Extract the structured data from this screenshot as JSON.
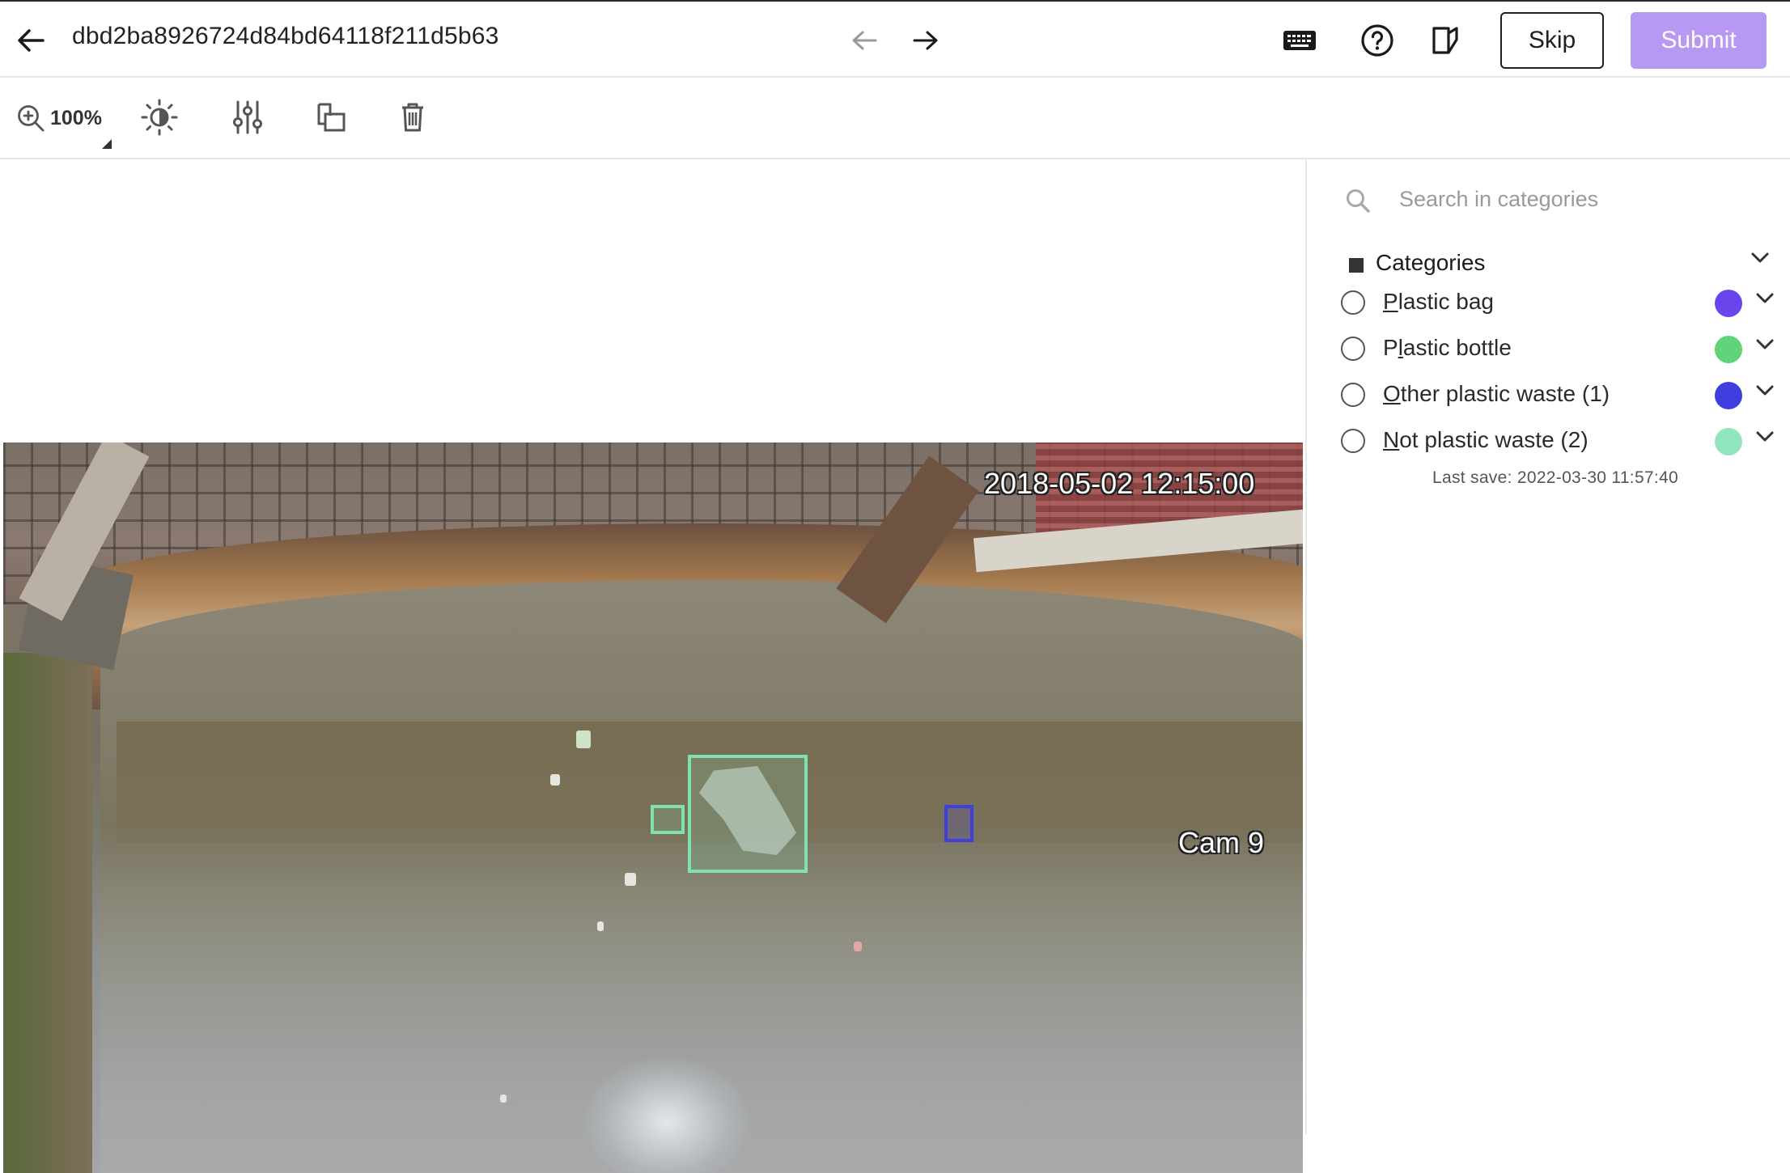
{
  "header": {
    "title": "dbd2ba8926724d84bd64118f211d5b63",
    "skip_label": "Skip",
    "submit_label": "Submit",
    "submit_color": "#b798f2"
  },
  "toolbar": {
    "zoom_label": "100%"
  },
  "image": {
    "timestamp_overlay": "2018-05-02 12:15:00",
    "camera_overlay": "Cam 9",
    "annotations": [
      {
        "category": "Not plastic waste",
        "color": "#7fe0b0"
      },
      {
        "category": "Not plastic waste",
        "color": "#7fe0b0"
      },
      {
        "category": "Other plastic waste",
        "color": "#3f3fe0"
      }
    ]
  },
  "sidebar": {
    "search_placeholder": "Search in categories",
    "categories_header": "Categories",
    "categories": [
      {
        "first": "P",
        "rest": "lastic bag",
        "color": "#6b45ec"
      },
      {
        "first": "Pl",
        "rest": "astic bottle",
        "color": "#5fd27a",
        "underline_index": 1
      },
      {
        "first": "O",
        "rest": "ther plastic waste (1)",
        "color": "#3f3fe0"
      },
      {
        "first": "N",
        "rest": "ot plastic waste (2)",
        "color": "#8fe6be"
      }
    ],
    "last_save": "Last save: 2022-03-30 11:57:40"
  }
}
